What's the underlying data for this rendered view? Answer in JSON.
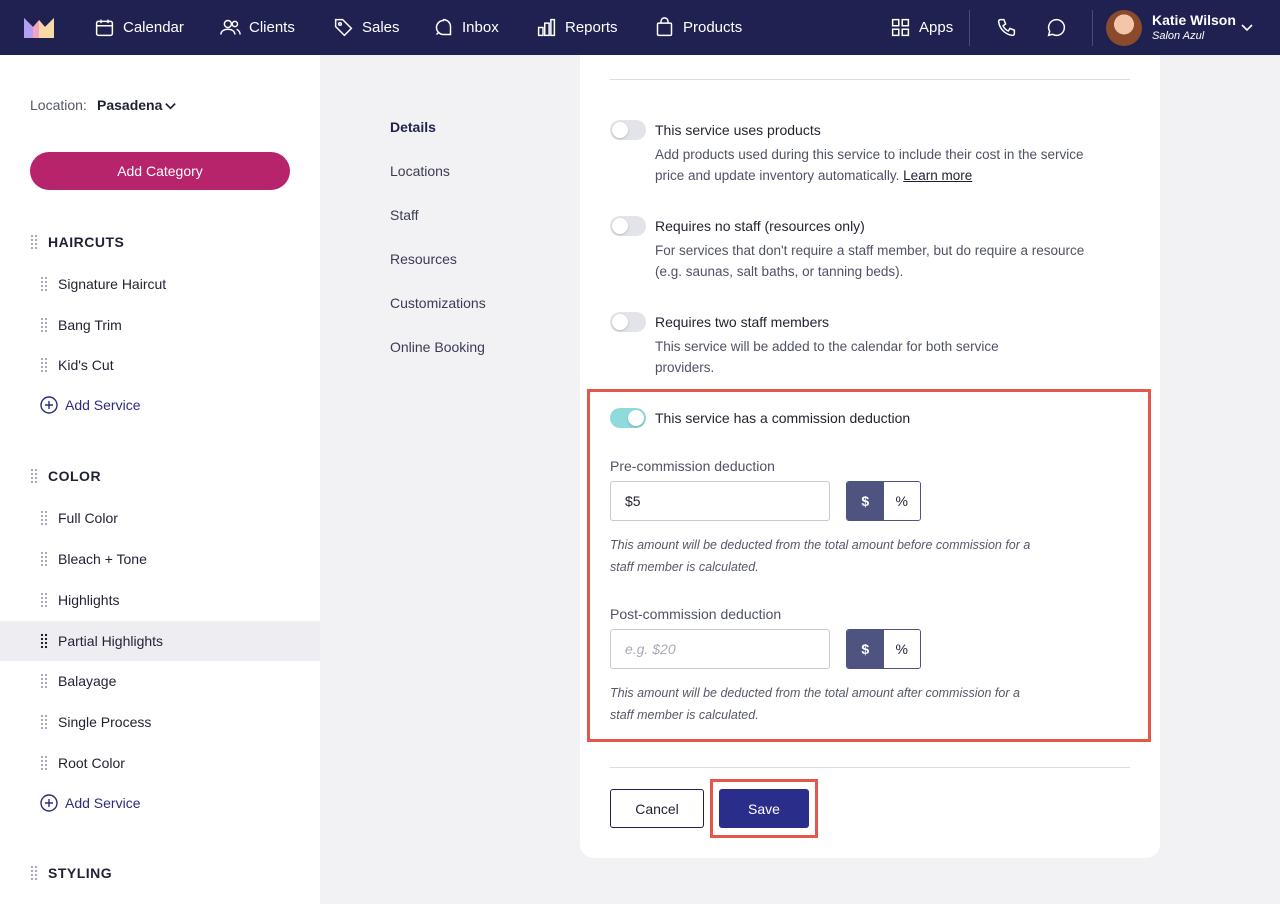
{
  "colors": {
    "nav_bg": "#1f2151",
    "brand_pink": "#b8246b",
    "primary": "#2b2d8a",
    "toggle_on": "#8fdbdc",
    "highlight": "#e4574b"
  },
  "nav": {
    "items": [
      {
        "label": "Calendar",
        "icon": "calendar-icon"
      },
      {
        "label": "Clients",
        "icon": "users-icon"
      },
      {
        "label": "Sales",
        "icon": "tag-icon"
      },
      {
        "label": "Inbox",
        "icon": "chat-icon"
      },
      {
        "label": "Reports",
        "icon": "bar-chart-icon"
      },
      {
        "label": "Products",
        "icon": "shopping-bag-icon"
      }
    ],
    "apps_label": "Apps",
    "user": {
      "name": "Katie Wilson",
      "salon": "Salon Azul"
    }
  },
  "sidebar": {
    "location_label": "Location:",
    "location_value": "Pasadena",
    "add_category": "Add Category",
    "categories": [
      {
        "name": "HAIRCUTS",
        "services": [
          "Signature Haircut",
          "Bang Trim",
          "Kid's Cut"
        ],
        "add_service": "Add Service"
      },
      {
        "name": "COLOR",
        "services": [
          "Full Color",
          "Bleach + Tone",
          "Highlights",
          "Partial Highlights",
          "Balayage",
          "Single Process",
          "Root Color"
        ],
        "add_service": "Add Service",
        "active_service": "Partial Highlights"
      },
      {
        "name": "STYLING"
      }
    ]
  },
  "subnav": [
    "Details",
    "Locations",
    "Staff",
    "Resources",
    "Customizations",
    "Online Booking"
  ],
  "options": [
    {
      "title": "This service uses products",
      "desc": "Add products used during this service to include their cost in the service price and update inventory automatically.",
      "link": "Learn more",
      "on": false
    },
    {
      "title": "Requires no staff (resources only)",
      "desc": "For services that don't require a staff member, but do require a resource (e.g. saunas, salt baths, or tanning beds).",
      "on": false
    },
    {
      "title": "Requires two staff members",
      "desc": "This service will be added to the calendar for both service providers.",
      "on": false
    },
    {
      "title": "This service has a commission deduction",
      "on": true
    }
  ],
  "commission": {
    "pre_label": "Pre-commission deduction",
    "pre_value": "$5",
    "pre_help": "This amount will be deducted from the total amount before commission for a staff member is calculated.",
    "post_label": "Post-commission deduction",
    "post_placeholder": "e.g. $20",
    "post_help": "This amount will be deducted from the total amount after commission for a staff member is calculated.",
    "unit_dollar": "$",
    "unit_percent": "%"
  },
  "buttons": {
    "cancel": "Cancel",
    "save": "Save"
  }
}
